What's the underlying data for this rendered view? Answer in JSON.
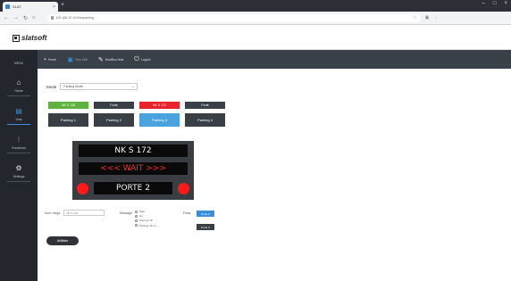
{
  "browser": {
    "tab_title": "SLAT",
    "url": "192.168.10.10/vms/parking",
    "window_controls": [
      "–",
      "□",
      "×"
    ]
  },
  "app": {
    "logo_text": "slatsoft"
  },
  "sidebar": {
    "menu_label": "MENU",
    "items": [
      {
        "label": "Home",
        "icon": "home-icon"
      },
      {
        "label": "Vms",
        "icon": "display-icon"
      },
      {
        "label": "Functions",
        "icon": "functions-icon"
      },
      {
        "label": "Settings",
        "icon": "settings-icon"
      }
    ]
  },
  "topnav": {
    "items": [
      {
        "label": "Home",
        "icon": "plus-icon"
      },
      {
        "label": "Vms Edit",
        "icon": "monitor-icon"
      },
      {
        "label": "Modifica testi",
        "icon": "pencil-icon"
      },
      {
        "label": "Logout",
        "icon": "power-icon"
      }
    ]
  },
  "main": {
    "mode_label": "Mode",
    "mode_value": "Parking Mode",
    "tags": [
      {
        "label": "NK S 138",
        "color": "#5fb23f"
      },
      {
        "label": "Porte",
        "color": "#3a3f45"
      },
      {
        "label": "NK S 172",
        "color": "#e8232a"
      },
      {
        "label": "Porte",
        "color": "#3a3f45"
      }
    ],
    "parkings": [
      "Parking 1",
      "Parking 2",
      "Parking 3",
      "Parking 4"
    ],
    "active_parking": 2
  },
  "display": {
    "line1": "NK S 172",
    "line2": "<<< WAIT >>>",
    "line3": "PORTE 2",
    "line1_color": "#f2f2f2",
    "line2_color": "#ff2a2a",
    "lamp_color": "#ff1a1a"
  },
  "form": {
    "plate_label": "Num. targa",
    "plate_value": "NK S 172",
    "message_label": "Message",
    "messages": [
      "Wait",
      "Go",
      "Parking full",
      "Parking full on ..."
    ],
    "porta_label": "Porta",
    "porta_btn1": "Porte 2",
    "porta_btn2": "Porte 3",
    "enable_label": "Abilitato"
  }
}
